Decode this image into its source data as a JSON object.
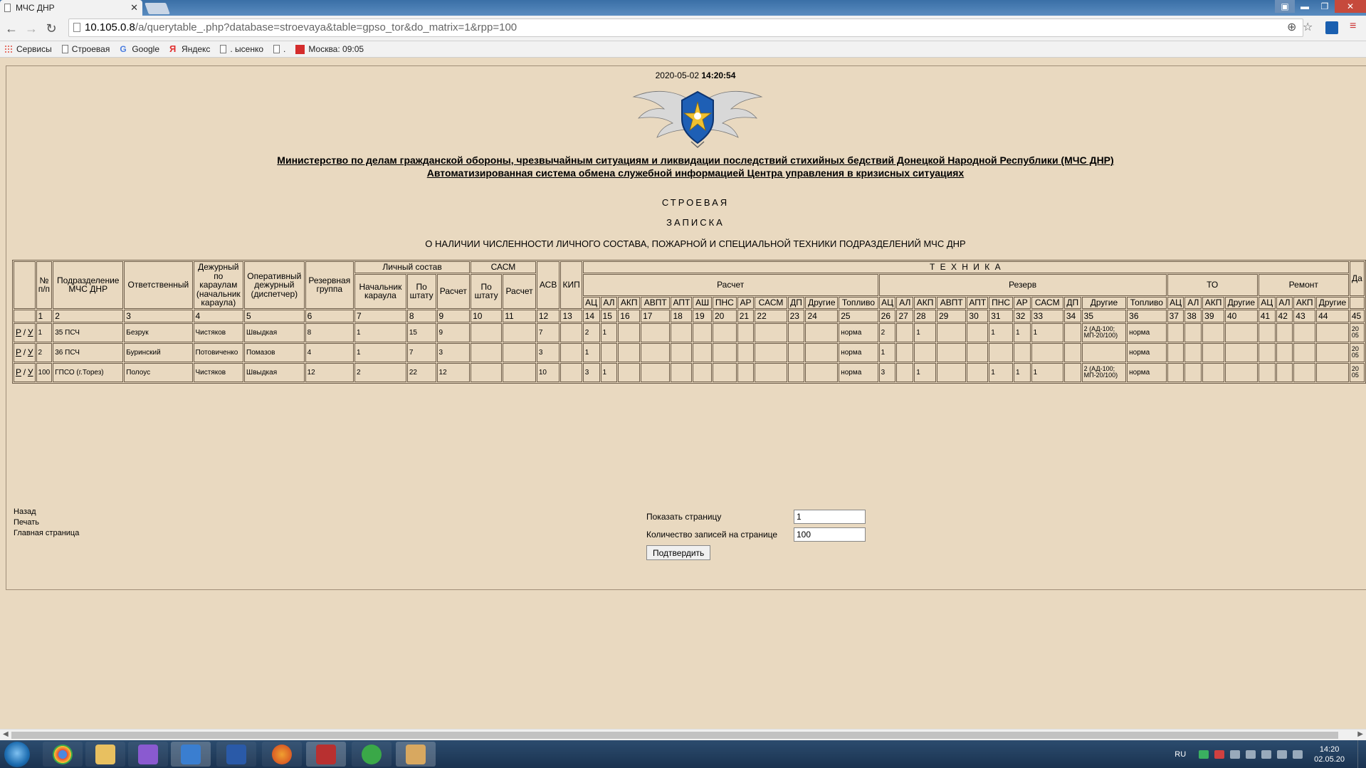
{
  "browser": {
    "tab_title": "МЧС ДНР",
    "url_host": "10.105.0.8",
    "url_path": "/a/querytable_.php?database=stroevaya&table=gpso_tor&do_matrix=1&rpp=100",
    "bookmarks": [
      {
        "label": "Сервисы",
        "icon": "apps-icon"
      },
      {
        "label": "Строевая",
        "icon": "page-icon"
      },
      {
        "label": "Google",
        "icon": "google-icon"
      },
      {
        "label": "Яндекс",
        "icon": "yandex-icon"
      },
      {
        "label": ". ысенко",
        "icon": "page-icon"
      },
      {
        "label": ".",
        "icon": "page-icon"
      },
      {
        "label": "Москва: 09:05",
        "icon": "weather-icon"
      }
    ]
  },
  "header": {
    "date": "2020-05-02",
    "time": "14:20:54",
    "ministry": "Министерство по делам гражданской обороны, чрезвычайным ситуациям и ликвидации последствий стихийных бедствий Донецкой Народной Республики (МЧС ДНР)",
    "system": "Автоматизированная система обмена служебной информацией Центра управления в кризисных ситуациях",
    "title1": "СТРОЕВАЯ",
    "title2": "ЗАПИСКА",
    "subtitle": "О НАЛИЧИИ ЧИСЛЕННОСТИ ЛИЧНОГО СОСТАВА, ПОЖАРНОЙ И СПЕЦИАЛЬНОЙ ТЕХНИКИ ПОДРАЗДЕЛЕНИЙ МЧС ДНР"
  },
  "table": {
    "headers": {
      "num": "№ п/п",
      "unit": "Подразделение МЧС ДНР",
      "responsible": "Ответственный",
      "duty_guard": "Дежурный по караулам (начальник караула)",
      "operational": "Оперативный дежурный (диспетчер)",
      "reserve_group": "Резервная группа",
      "personnel": "Личный состав",
      "sasm": "САСМ",
      "asv": "АСВ",
      "kip": "КИП",
      "tech": "Т Е Х Н И К А",
      "calc": "Расчет",
      "reserve": "Резерв",
      "to": "ТО",
      "repair": "Ремонт",
      "last_partial": "Да",
      "chief": "Начальник караула",
      "staff": "По штату",
      "crew": "Расчет",
      "sasm_staff": "По штату",
      "sasm_crew": "Расчет",
      "calc_cols": [
        "АЦ",
        "АЛ",
        "АКП",
        "АВПТ",
        "АПТ",
        "АШ",
        "ПНС",
        "АР",
        "САСМ",
        "ДП",
        "Другие",
        "Топливо"
      ],
      "reserve_cols": [
        "АЦ",
        "АЛ",
        "АКП",
        "АВПТ",
        "АПТ",
        "ПНС",
        "АР",
        "САСМ",
        "ДП",
        "Другие",
        "Топливо"
      ],
      "to_cols": [
        "АЦ",
        "АЛ",
        "АКП",
        "Другие"
      ],
      "repair_cols": [
        "АЦ",
        "АЛ",
        "АКП",
        "Другие"
      ]
    },
    "column_numbers": [
      "",
      "1",
      "2",
      "3",
      "4",
      "5",
      "6",
      "7",
      "8",
      "9",
      "10",
      "11",
      "12",
      "13",
      "14",
      "15",
      "16",
      "17",
      "18",
      "19",
      "20",
      "21",
      "22",
      "23",
      "24",
      "25",
      "26",
      "27",
      "28",
      "29",
      "30",
      "31",
      "32",
      "33",
      "34",
      "35",
      "36",
      "37",
      "38",
      "39",
      "40",
      "41",
      "42",
      "43",
      "44",
      "45"
    ],
    "row_actions": {
      "edit": "Р",
      "sep": "/",
      "delete": "У"
    },
    "rows": [
      {
        "cells": [
          "1",
          "35 ПСЧ",
          "Безрук",
          "Чистяков",
          "Швыдкая",
          "8",
          "1",
          "15",
          "9",
          "",
          "",
          "7",
          "",
          "2",
          "1",
          "",
          "",
          "",
          "",
          "",
          "",
          "",
          "",
          "",
          "норма",
          "2",
          "",
          "1",
          "",
          "",
          "1",
          "1",
          "1",
          "",
          "2 (АД-100; МП-20/100)",
          "норма",
          "",
          "",
          "",
          "",
          "",
          "",
          "",
          "",
          "20 05"
        ]
      },
      {
        "cells": [
          "2",
          "36 ПСЧ",
          "Буринский",
          "Потовиченко",
          "Помазов",
          "4",
          "1",
          "7",
          "3",
          "",
          "",
          "3",
          "",
          "1",
          "",
          "",
          "",
          "",
          "",
          "",
          "",
          "",
          "",
          "",
          "норма",
          "1",
          "",
          "",
          "",
          "",
          "",
          "",
          "",
          "",
          "",
          "норма",
          "",
          "",
          "",
          "",
          "",
          "",
          "",
          "",
          "20 05"
        ]
      },
      {
        "cells": [
          "100",
          "ГПСО (г.Торез)",
          "Полоус",
          "Чистяков",
          "Швыдкая",
          "12",
          "2",
          "22",
          "12",
          "",
          "",
          "10",
          "",
          "3",
          "1",
          "",
          "",
          "",
          "",
          "",
          "",
          "",
          "",
          "",
          "норма",
          "3",
          "",
          "1",
          "",
          "",
          "1",
          "1",
          "1",
          "",
          "2 (АД-100; МП-20/100)",
          "норма",
          "",
          "",
          "",
          "",
          "",
          "",
          "",
          "",
          "20 05"
        ]
      }
    ]
  },
  "footer_links": [
    "Назад",
    "Печать",
    "Главная страница"
  ],
  "pager": {
    "page_label": "Показать страницу",
    "page_value": "1",
    "rpp_label": "Количество записей на странице",
    "rpp_value": "100",
    "submit": "Подтвердить"
  },
  "taskbar": {
    "lang": "RU",
    "time": "14:20",
    "date": "02.05.20"
  }
}
